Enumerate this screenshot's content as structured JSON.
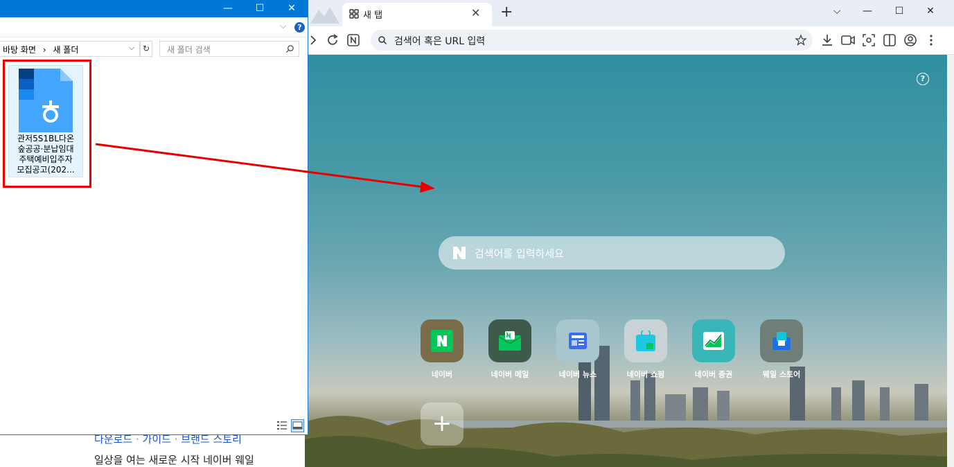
{
  "background_page": {
    "links": [
      "다운로드",
      "가이드",
      "브랜드 스토리"
    ],
    "link_separator": "·",
    "text": "일상을 여는 새로운 시작 네이버 웨일"
  },
  "browser": {
    "tab_title": "새 탭",
    "omnibox_placeholder": "검색어 혹은 URL 입력",
    "search_placeholder": "검색어를 입력하세요",
    "shortcuts": [
      {
        "label": "네이버",
        "icon": "naver-icon",
        "bg": "#7a6c48"
      },
      {
        "label": "네이버 메일",
        "icon": "naver-mail-icon",
        "bg": "#3e5a4a"
      },
      {
        "label": "네이버 뉴스",
        "icon": "naver-news-icon",
        "bg": "#a7c6cd"
      },
      {
        "label": "네이버 쇼핑",
        "icon": "naver-shopping-icon",
        "bg": "#c9d2d4"
      },
      {
        "label": "네이버 증권",
        "icon": "naver-stock-icon",
        "bg": "#38b6b8"
      },
      {
        "label": "웨일 스토어",
        "icon": "whale-store-icon",
        "bg": "#6f7f78"
      }
    ],
    "accent": "#0b8fe2"
  },
  "explorer": {
    "breadcrumb": [
      "바탕 화면",
      "새 폴더"
    ],
    "breadcrumb_separator": "›",
    "search_placeholder": "새 폴더 검색",
    "file": {
      "lines": [
        "관저5S1BL다온",
        "숲공공·분납임대",
        "주택예비입주자",
        "모집공고(202..."
      ]
    },
    "title_color": "#0078d7"
  }
}
